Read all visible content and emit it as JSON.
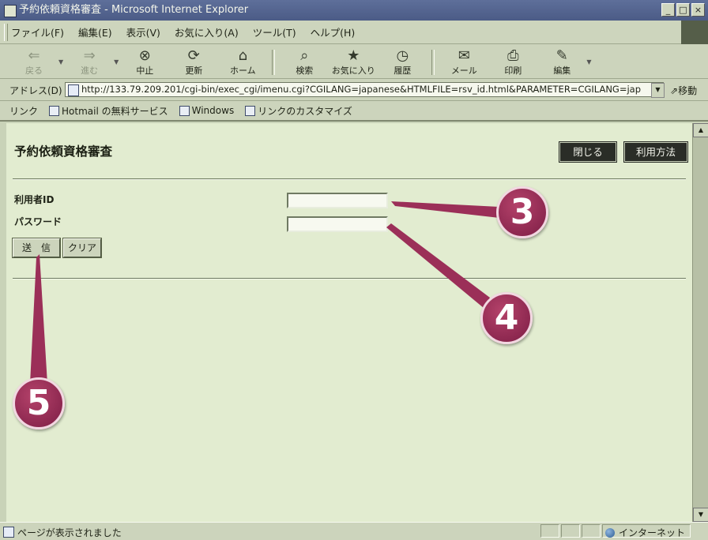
{
  "window": {
    "title": "予約依頼資格審査 - Microsoft Internet Explorer",
    "minimize": "_",
    "restore": "□",
    "close": "×"
  },
  "menu": [
    "ファイル(F)",
    "編集(E)",
    "表示(V)",
    "お気に入り(A)",
    "ツール(T)",
    "ヘルプ(H)"
  ],
  "toolbar": {
    "back": "戻る",
    "forward": "進む",
    "stop": "中止",
    "refresh": "更新",
    "home": "ホーム",
    "search": "検索",
    "favorites": "お気に入り",
    "history": "履歴",
    "mail": "メール",
    "print": "印刷",
    "edit": "編集"
  },
  "address": {
    "label": "アドレス(D)",
    "url": "http://133.79.209.201/cgi-bin/exec_cgi/imenu.cgi?CGILANG=japanese&HTMLFILE=rsv_id.html&PARAMETER=CGILANG=jap",
    "go": "移動"
  },
  "links": {
    "label": "リンク",
    "items": [
      "Hotmail の無料サービス",
      "Windows",
      "リンクのカスタマイズ"
    ]
  },
  "page": {
    "title": "予約依頼資格審査",
    "close_button": "閉じる",
    "help_button": "利用方法",
    "user_id_label": "利用者ID",
    "password_label": "パスワード",
    "submit_button": "送　信",
    "clear_button": "クリア"
  },
  "callouts": [
    "3",
    "4",
    "5"
  ],
  "status": {
    "text": "ページが表示されました",
    "zone": "インターネット"
  },
  "colors": {
    "callout": "#9b2f58",
    "content_bg": "#e2ecd0",
    "chrome": "#ccd4bc"
  }
}
